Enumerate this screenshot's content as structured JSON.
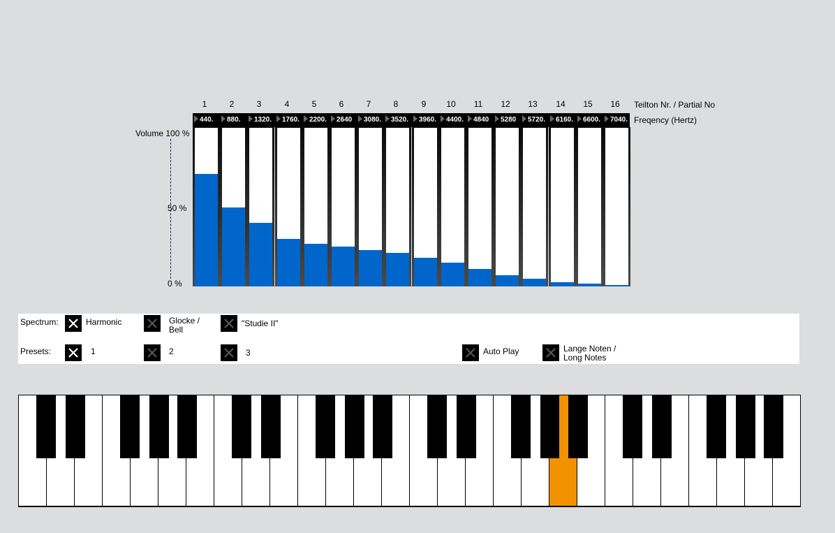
{
  "header": {
    "partial_axis_label": "Teilton Nr. / Partial No",
    "frequency_axis_label": "Freqency (Hertz)",
    "volume_labels": {
      "top": "Volume 100 %",
      "mid": "50 %",
      "bottom": "0 %"
    }
  },
  "partials": [
    {
      "number": "1",
      "frequency": "440.",
      "volume_pct": 71
    },
    {
      "number": "2",
      "frequency": "880.",
      "volume_pct": 50
    },
    {
      "number": "3",
      "frequency": "1320.",
      "volume_pct": 40
    },
    {
      "number": "4",
      "frequency": "1760.",
      "volume_pct": 30
    },
    {
      "number": "5",
      "frequency": "2200.",
      "volume_pct": 27
    },
    {
      "number": "6",
      "frequency": "2640",
      "volume_pct": 25
    },
    {
      "number": "7",
      "frequency": "3080.",
      "volume_pct": 23
    },
    {
      "number": "8",
      "frequency": "3520.",
      "volume_pct": 21
    },
    {
      "number": "9",
      "frequency": "3960.",
      "volume_pct": 18
    },
    {
      "number": "10",
      "frequency": "4400.",
      "volume_pct": 15
    },
    {
      "number": "11",
      "frequency": "4840",
      "volume_pct": 11
    },
    {
      "number": "12",
      "frequency": "5280",
      "volume_pct": 7
    },
    {
      "number": "13",
      "frequency": "5720.",
      "volume_pct": 5
    },
    {
      "number": "14",
      "frequency": "6160.",
      "volume_pct": 2.7
    },
    {
      "number": "15",
      "frequency": "6600.",
      "volume_pct": 1.8
    },
    {
      "number": "16",
      "frequency": "7040.",
      "volume_pct": 0.9
    }
  ],
  "controls": {
    "spectrum_label": "Spectrum:",
    "presets_label": "Presets:",
    "spectrum_options": [
      {
        "label": "Harmonic",
        "selected": true
      },
      {
        "label": "Glocke / Bell",
        "line1": "Glocke /",
        "line2": "Bell",
        "selected": false
      },
      {
        "label": "\"Studie II\"",
        "selected": false
      }
    ],
    "preset_options": [
      {
        "label": "1",
        "selected": true
      },
      {
        "label": "2",
        "selected": false
      },
      {
        "label": "3",
        "selected": false
      }
    ],
    "auto_play": {
      "label": "Auto Play",
      "selected": false
    },
    "long_notes": {
      "label": "Lange Noten / Long Notes",
      "line1": "Lange Noten /",
      "line2": "Long Notes",
      "selected": false
    }
  },
  "keyboard": {
    "octaves": 4,
    "start_note": "C",
    "active_note": "A",
    "active_octave_index": 2,
    "colors": {
      "active": "#f39200",
      "white": "#ffffff",
      "black": "#000000"
    }
  },
  "colors": {
    "background": "#dcdddf",
    "volume_fill": "#0066cc"
  }
}
